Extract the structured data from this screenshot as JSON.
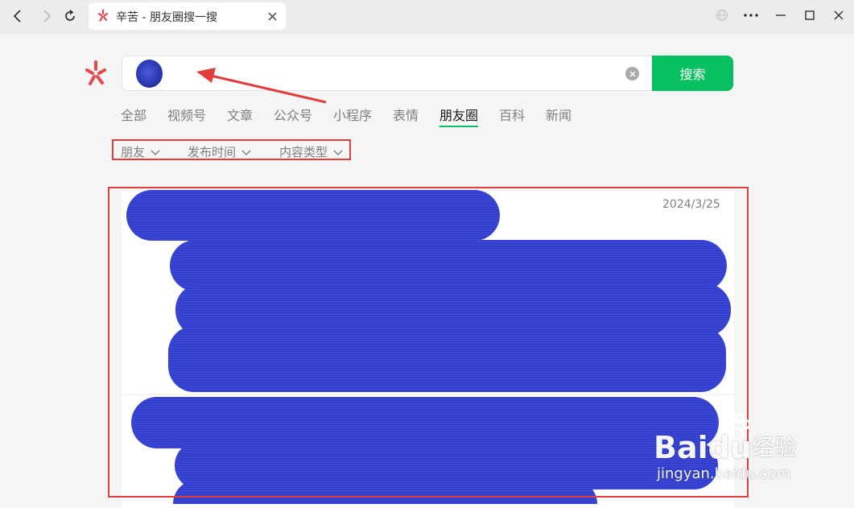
{
  "tab": {
    "title": "辛苦 - 朋友圈搜一搜"
  },
  "search": {
    "button_label": "搜索"
  },
  "categories": [
    {
      "label": "全部",
      "active": false
    },
    {
      "label": "视频号",
      "active": false
    },
    {
      "label": "文章",
      "active": false
    },
    {
      "label": "公众号",
      "active": false
    },
    {
      "label": "小程序",
      "active": false
    },
    {
      "label": "表情",
      "active": false
    },
    {
      "label": "朋友圈",
      "active": true
    },
    {
      "label": "百科",
      "active": false
    },
    {
      "label": "新闻",
      "active": false
    }
  ],
  "filters": [
    {
      "label": "朋友"
    },
    {
      "label": "发布时间"
    },
    {
      "label": "内容类型"
    }
  ],
  "results": [
    {
      "date": "2024/3/25"
    }
  ],
  "watermark": {
    "brand": "Baidu",
    "suffix": "经验",
    "url": "jingyan.baidu.com"
  },
  "colors": {
    "accent": "#07c160",
    "annotation": "#e23d3d",
    "redaction": "#3a46d6"
  }
}
